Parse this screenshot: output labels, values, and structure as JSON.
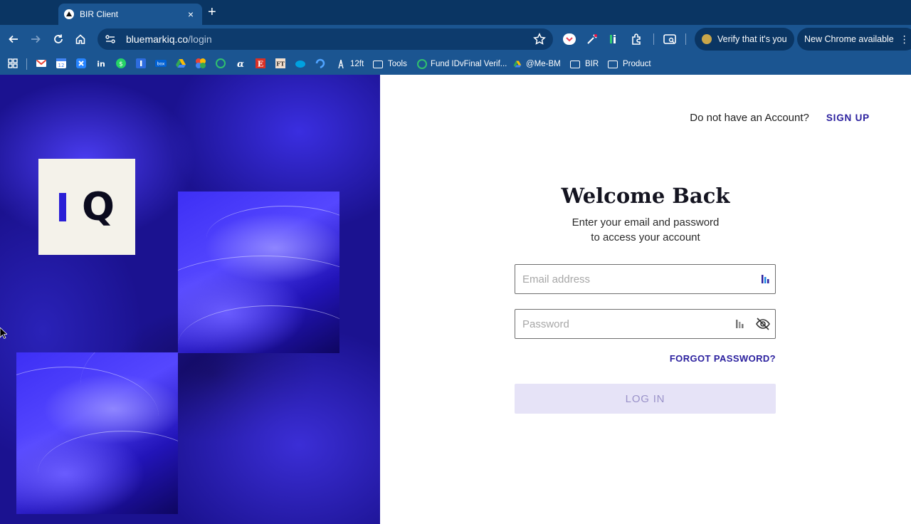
{
  "browser": {
    "tab": {
      "title": "BIR Client",
      "close_glyph": "×"
    },
    "new_tab_glyph": "+",
    "address": {
      "host": "bluemarkiq.co",
      "path": "/login"
    },
    "verify_pill": "Verify that it's you",
    "update_pill": "New Chrome available",
    "kebab_glyph": "⋮",
    "bookmarks": [
      {
        "type": "icon",
        "icon": "apps-grid-icon"
      },
      {
        "type": "icon",
        "icon": "gmail-icon",
        "color": "#ea4335"
      },
      {
        "type": "icon",
        "icon": "calendar-icon",
        "color": "#4285f4"
      },
      {
        "type": "icon",
        "icon": "jira-icon",
        "color": "#2684ff"
      },
      {
        "type": "icon",
        "icon": "linkedin-icon",
        "color": "#0a66c2"
      },
      {
        "type": "icon",
        "icon": "whatsapp-icon",
        "color": "#25d366"
      },
      {
        "type": "icon",
        "icon": "info-icon",
        "color": "#2d6cdf"
      },
      {
        "type": "icon",
        "icon": "box-icon",
        "color": "#0061d5"
      },
      {
        "type": "icon",
        "icon": "drive-icon",
        "color": "#34a853"
      },
      {
        "type": "icon",
        "icon": "photos-icon",
        "color": "#fbbc04"
      },
      {
        "type": "icon",
        "icon": "circle-icon",
        "color": "#30c06e"
      },
      {
        "type": "icon",
        "icon": "alpha-icon",
        "color": "#4285f4"
      },
      {
        "type": "icon",
        "icon": "e-icon",
        "color": "#d93025"
      },
      {
        "type": "icon",
        "icon": "ft-icon",
        "color": "#f2dfce"
      },
      {
        "type": "icon",
        "icon": "salesforce-icon",
        "color": "#00a1e0"
      },
      {
        "type": "icon",
        "icon": "swirl-icon",
        "color": "#4fa3ff"
      },
      {
        "type": "link",
        "label": "12ft",
        "icon": "ladder-icon"
      },
      {
        "type": "folder",
        "label": "Tools"
      },
      {
        "type": "link",
        "label": "Fund IDvFinal Verif...",
        "icon": "circle-icon"
      },
      {
        "type": "link",
        "label": "@Me-BM",
        "icon": "drive-icon"
      },
      {
        "type": "folder",
        "label": "BIR"
      },
      {
        "type": "folder",
        "label": "Product"
      }
    ]
  },
  "brand": {
    "logo_letter_q": "Q"
  },
  "auth": {
    "signup_prompt": "Do not have an Account?",
    "signup_label": "SIGN UP",
    "title": "Welcome Back",
    "subtitle_line1": "Enter your email and password",
    "subtitle_line2": "to access your account",
    "email_placeholder": "Email address",
    "password_placeholder": "Password",
    "forgot_label": "FORGOT PASSWORD?",
    "login_label": "LOG IN"
  },
  "colors": {
    "chrome_bg": "#1b5591",
    "accent": "#2a1f9e",
    "hero_blue": "#3d2ff5",
    "login_disabled_bg": "#e6e3f7"
  }
}
